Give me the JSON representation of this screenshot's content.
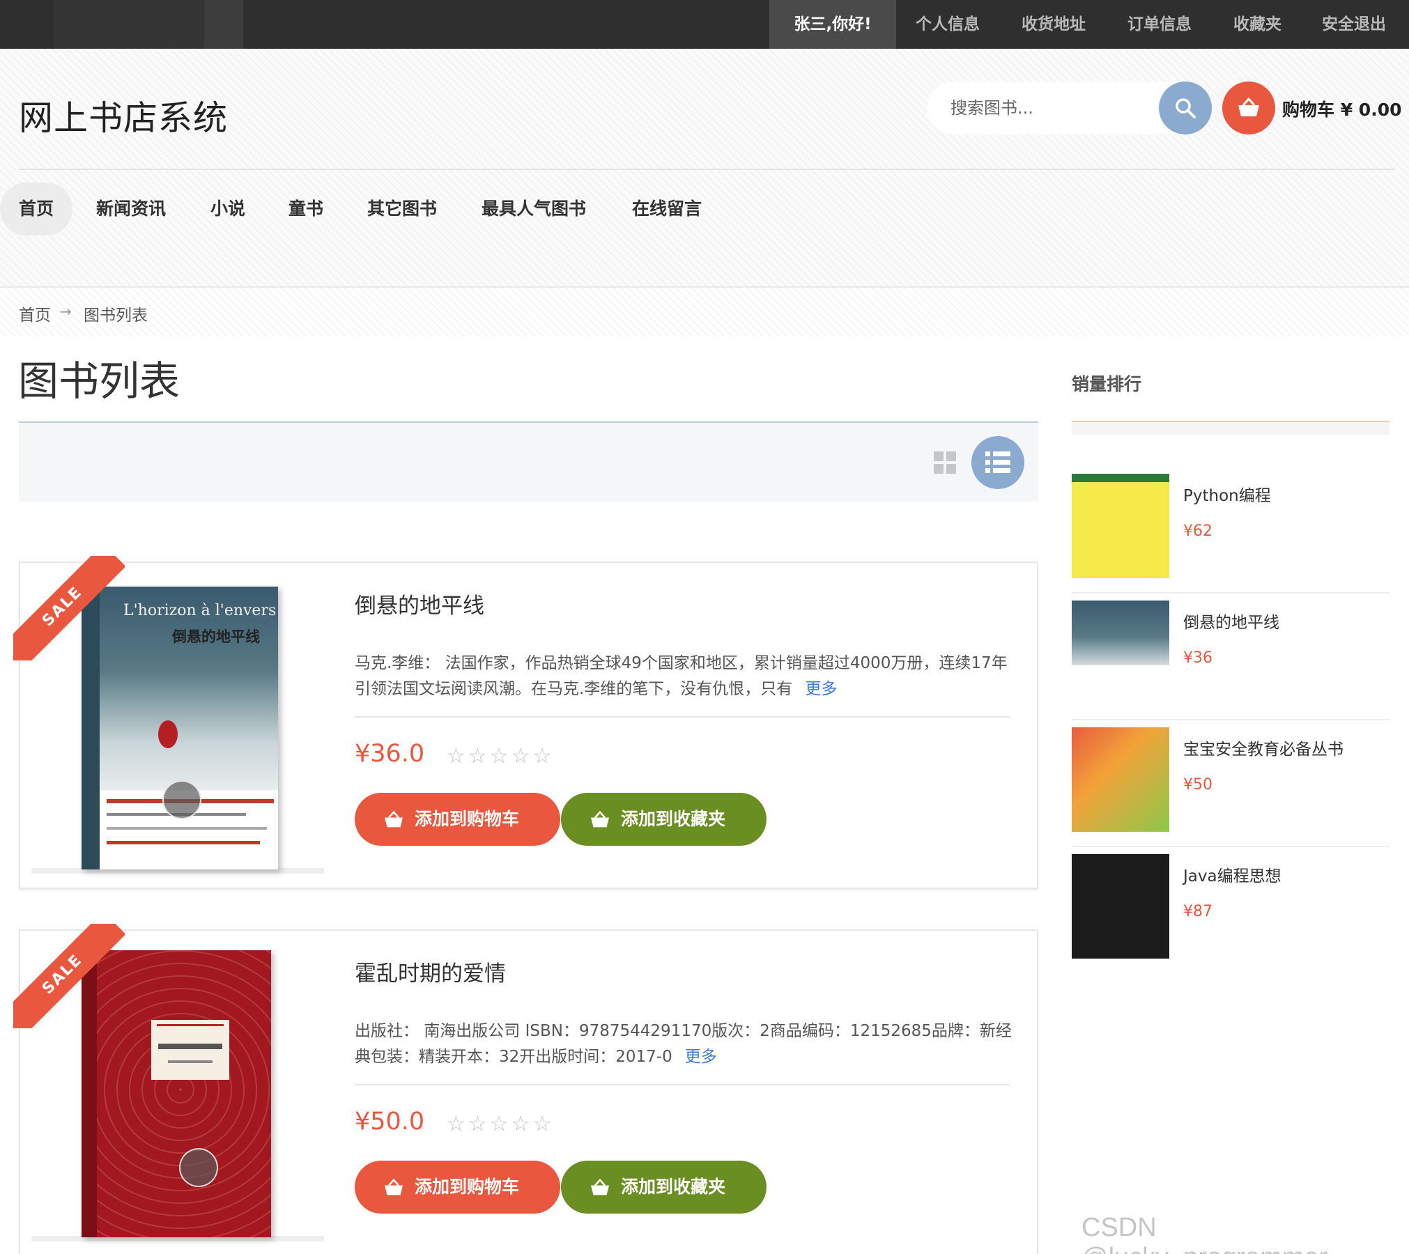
{
  "topbar": {
    "greeting": "张三,你好!",
    "links": [
      "个人信息",
      "收货地址",
      "订单信息",
      "收藏夹",
      "安全退出"
    ]
  },
  "header": {
    "brand": "网上书店系统",
    "search_placeholder": "搜索图书...",
    "cart_label": "购物车 ¥ 0.00"
  },
  "nav": [
    "首页",
    "新闻资讯",
    "小说",
    "童书",
    "其它图书",
    "最具人气图书",
    "在线留言"
  ],
  "breadcrumb": {
    "home": "首页",
    "arrow": "→",
    "current": "图书列表"
  },
  "page_title": "图书列表",
  "sale_badge": "SALE",
  "cover1": {
    "fr_title": "L'horizon à l'envers",
    "cn_title": "倒悬的地平线"
  },
  "products": [
    {
      "title": "倒悬的地平线",
      "desc": "马克.李维： 法国作家，作品热销全球49个国家和地区，累计销量超过4000万册，连续17年引领法国文坛阅读风潮。在马克.李维的笔下，没有仇恨，只有",
      "more": "更多",
      "price": "¥36.0",
      "stars": "☆☆☆☆☆",
      "add_cart": "添加到购物车",
      "add_fav": "添加到收藏夹"
    },
    {
      "title": "霍乱时期的爱情",
      "desc": "出版社： 南海出版公司 ISBN：9787544291170版次：2商品编码：12152685品牌：新经典包装：精装开本：32开出版时间：2017-0",
      "more": "更多",
      "price": "¥50.0",
      "stars": "☆☆☆☆☆",
      "add_cart": "添加到购物车",
      "add_fav": "添加到收藏夹"
    }
  ],
  "sidebar": {
    "title": "销量排行",
    "items": [
      {
        "name": "Python编程",
        "price": "¥62"
      },
      {
        "name": "倒悬的地平线",
        "price": "¥36"
      },
      {
        "name": "宝宝安全教育必备丛书",
        "price": "¥50"
      },
      {
        "name": "Java编程思想",
        "price": "¥87"
      }
    ]
  },
  "watermark": "CSDN @lucky_programmer",
  "colors": {
    "accent": "#e9573f",
    "secondary": "#6b8e23",
    "button_blue": "#8aaad0",
    "topbar": "#2f2f2f"
  }
}
